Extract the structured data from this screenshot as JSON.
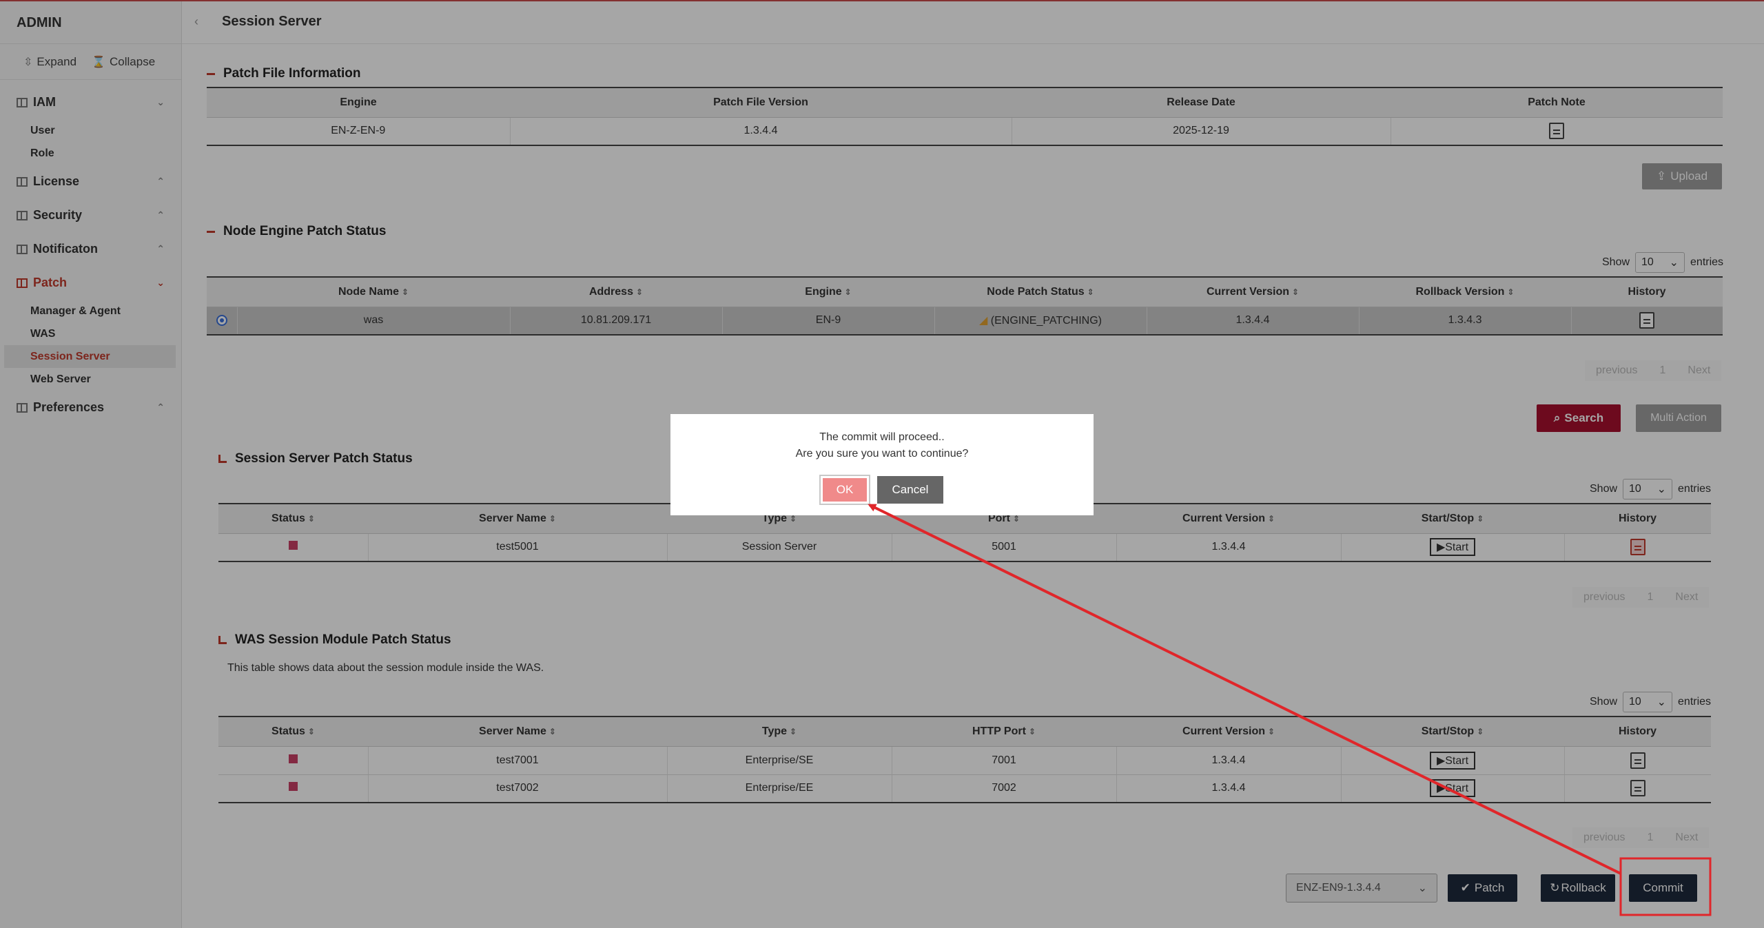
{
  "app": {
    "brand": "ADMIN",
    "page_title": "Session Server"
  },
  "sidebar": {
    "expand_label": "Expand",
    "collapse_label": "Collapse",
    "sections": [
      {
        "label": "IAM",
        "items": [
          "User",
          "Role"
        ]
      },
      {
        "label": "License"
      },
      {
        "label": "Security"
      },
      {
        "label": "Notificaton"
      },
      {
        "label": "Patch",
        "items": [
          "Manager & Agent",
          "WAS",
          "Session Server",
          "Web Server"
        ]
      },
      {
        "label": "Preferences"
      }
    ]
  },
  "patch_file": {
    "title": "Patch File Information",
    "headers": [
      "Engine",
      "Patch File Version",
      "Release Date",
      "Patch Note"
    ],
    "row": [
      "EN-Z-EN-9",
      "1.3.4.4",
      "2025-12-19"
    ],
    "upload_label": "Upload"
  },
  "node_engine": {
    "title": "Node Engine Patch Status",
    "show": "Show",
    "entries": "entries",
    "page_size": "10",
    "headers": [
      "Node Name",
      "Address",
      "Engine",
      "Node Patch Status",
      "Current Version",
      "Rollback Version",
      "History"
    ],
    "row": [
      "was",
      "10.81.209.171",
      "EN-9",
      "(ENGINE_PATCHING)",
      "1.3.4.4",
      "1.3.4.3"
    ],
    "pager": [
      "previous",
      "1",
      "Next"
    ],
    "search_label": "Search",
    "multi_action_label": "Multi Action"
  },
  "session_server": {
    "title": "Session Server Patch Status",
    "show": "Show",
    "entries": "entries",
    "page_size": "10",
    "headers": [
      "Status",
      "Server Name",
      "Type",
      "Port",
      "Current Version",
      "Start/Stop",
      "History"
    ],
    "row": [
      "test5001",
      "Session Server",
      "5001",
      "1.3.4.4",
      "Start"
    ],
    "pager": [
      "previous",
      "1",
      "Next"
    ]
  },
  "was_module": {
    "title": "WAS Session Module Patch Status",
    "description": "This table shows data about the session module inside the WAS.",
    "show": "Show",
    "entries": "entries",
    "page_size": "10",
    "headers": [
      "Status",
      "Server Name",
      "Type",
      "HTTP Port",
      "Current Version",
      "Start/Stop",
      "History"
    ],
    "rows": [
      [
        "test7001",
        "Enterprise/SE",
        "7001",
        "1.3.4.4",
        "Start"
      ],
      [
        "test7002",
        "Enterprise/EE",
        "7002",
        "1.3.4.4",
        "Start"
      ]
    ],
    "pager": [
      "previous",
      "1",
      "Next"
    ]
  },
  "footer": {
    "version_select": "ENZ-EN9-1.3.4.4",
    "patch_label": "Patch",
    "rollback_label": "Rollback",
    "commit_label": "Commit"
  },
  "dialog": {
    "line1": "The commit will proceed..",
    "line2": "Are you sure you want to continue?",
    "ok_label": "OK",
    "cancel_label": "Cancel"
  },
  "colors": {
    "accent": "#c0392b",
    "status_square": "#c94066",
    "search_button": "#a8102e",
    "commit_button": "#1e2a3c",
    "annotation": "#e0262a"
  }
}
